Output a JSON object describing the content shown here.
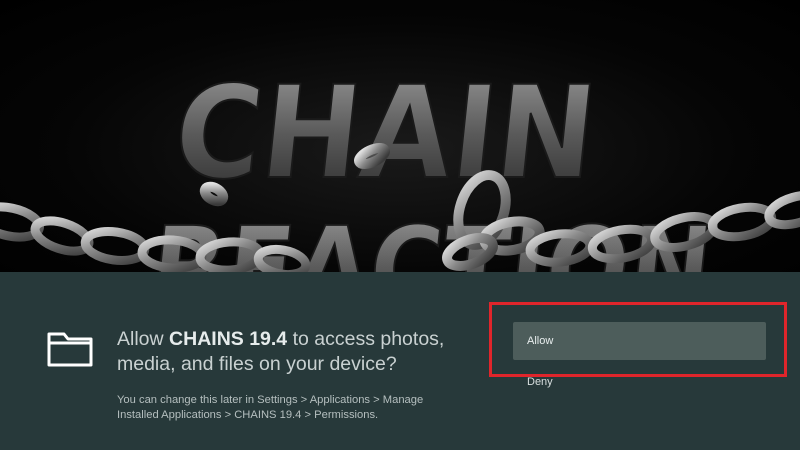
{
  "splash": {
    "logo_text": "CHAIN",
    "logo_text_line2": "REACTION"
  },
  "dialog": {
    "icon": "folder-icon",
    "question_prefix": "Allow ",
    "app_name": "CHAINS 19.4",
    "question_suffix": " to access photos, media, and files on your device?",
    "hint": "You can change this later in Settings > Applications > Manage Installed Applications > CHAINS 19.4 > Permissions.",
    "allow_label": "Allow",
    "deny_label": "Deny"
  },
  "colors": {
    "dialog_background": "#27393a",
    "allow_button": "#4d5d5b",
    "highlight": "#e0252b"
  }
}
